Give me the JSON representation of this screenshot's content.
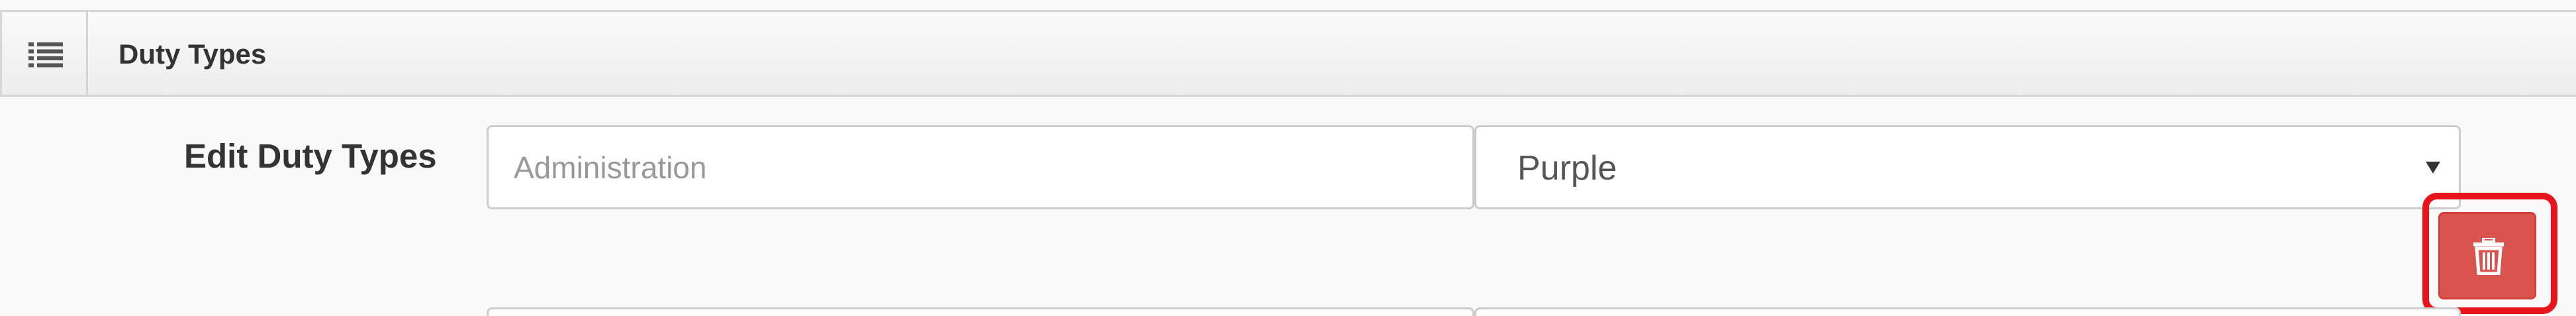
{
  "panel": {
    "title": "Duty Types",
    "icon": "list-icon"
  },
  "form": {
    "label": "Edit Duty Types",
    "name_input": {
      "value": "",
      "placeholder": "Administration"
    },
    "color_select": {
      "selected": "Purple"
    },
    "delete_button": {
      "icon": "trash-icon",
      "highlighted": true,
      "color": "#d9534f",
      "highlight_color": "#e8141b"
    }
  }
}
